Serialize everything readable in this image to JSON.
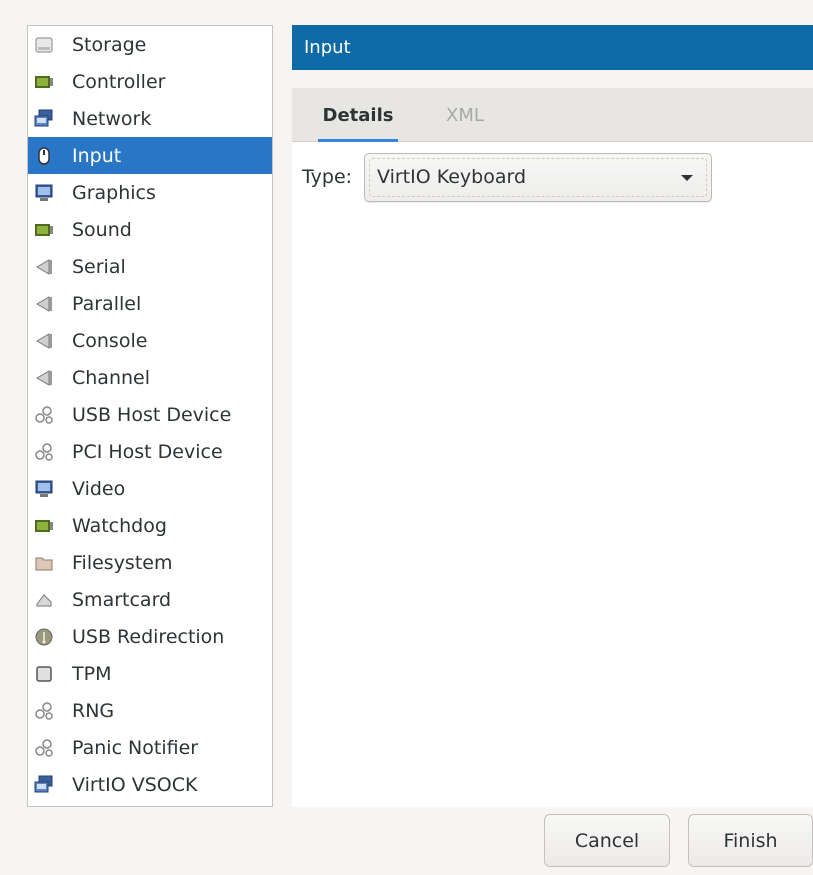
{
  "sidebar": {
    "items": [
      {
        "label": "Storage",
        "icon": "storage-icon",
        "selected": false
      },
      {
        "label": "Controller",
        "icon": "controller-icon",
        "selected": false
      },
      {
        "label": "Network",
        "icon": "network-icon",
        "selected": false
      },
      {
        "label": "Input",
        "icon": "mouse-icon",
        "selected": true
      },
      {
        "label": "Graphics",
        "icon": "monitor-icon",
        "selected": false
      },
      {
        "label": "Sound",
        "icon": "sound-card-icon",
        "selected": false
      },
      {
        "label": "Serial",
        "icon": "serial-port-icon",
        "selected": false
      },
      {
        "label": "Parallel",
        "icon": "parallel-port-icon",
        "selected": false
      },
      {
        "label": "Console",
        "icon": "console-icon",
        "selected": false
      },
      {
        "label": "Channel",
        "icon": "channel-icon",
        "selected": false
      },
      {
        "label": "USB Host Device",
        "icon": "usb-host-device-icon",
        "selected": false
      },
      {
        "label": "PCI Host Device",
        "icon": "pci-host-device-icon",
        "selected": false
      },
      {
        "label": "Video",
        "icon": "video-icon",
        "selected": false
      },
      {
        "label": "Watchdog",
        "icon": "watchdog-icon",
        "selected": false
      },
      {
        "label": "Filesystem",
        "icon": "folder-icon",
        "selected": false
      },
      {
        "label": "Smartcard",
        "icon": "smartcard-icon",
        "selected": false
      },
      {
        "label": "USB Redirection",
        "icon": "usb-redirection-icon",
        "selected": false
      },
      {
        "label": "TPM",
        "icon": "tpm-chip-icon",
        "selected": false
      },
      {
        "label": "RNG",
        "icon": "rng-icon",
        "selected": false
      },
      {
        "label": "Panic Notifier",
        "icon": "panic-notifier-icon",
        "selected": false
      },
      {
        "label": "VirtIO VSOCK",
        "icon": "vsock-icon",
        "selected": false
      }
    ]
  },
  "header": {
    "title": "Input"
  },
  "tabs": [
    {
      "label": "Details",
      "active": true
    },
    {
      "label": "XML",
      "active": false
    }
  ],
  "form": {
    "type_label": "Type:",
    "type_value": "VirtIO Keyboard"
  },
  "buttons": {
    "cancel": "Cancel",
    "finish": "Finish"
  },
  "colors": {
    "selection": "#2a76c6",
    "title_bar": "#0d6aa6",
    "tab_underline": "#3584e4"
  }
}
